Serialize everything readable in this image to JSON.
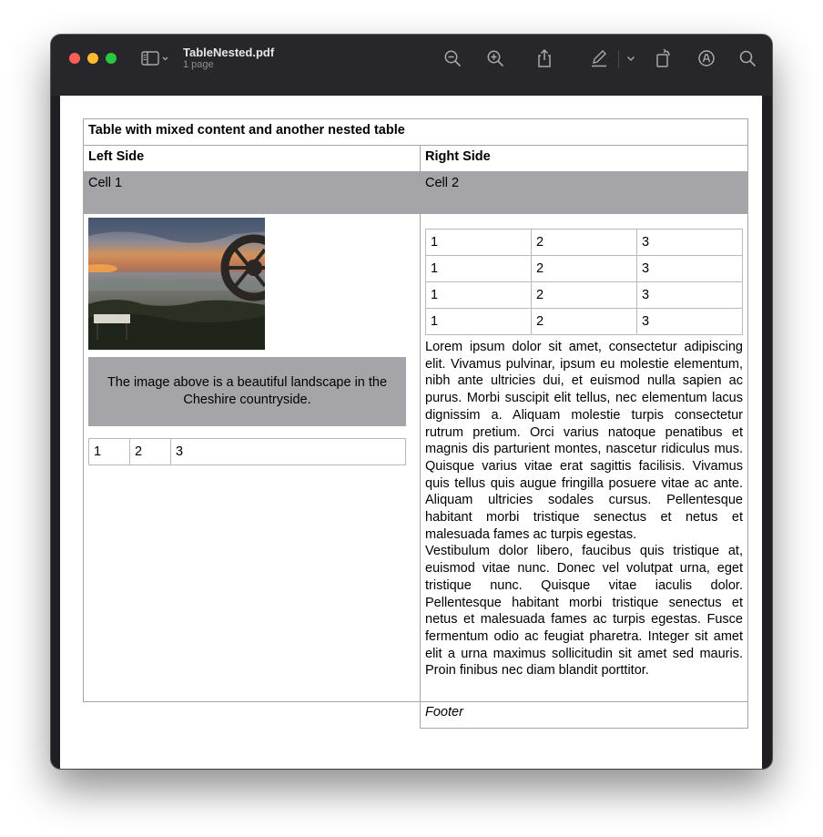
{
  "window": {
    "doc_title": "TableNested.pdf",
    "doc_subtitle": "1 page"
  },
  "toolbar": {
    "icons": [
      "sidebar-toggle-icon",
      "chevron-down-icon",
      "zoom-out-icon",
      "zoom-in-icon",
      "share-icon",
      "markup-pen-icon",
      "chevron-down-icon",
      "rotate-icon",
      "annotate-icon",
      "search-icon"
    ]
  },
  "document": {
    "table_title": "Table with mixed content and another nested table",
    "left_header": "Left Side",
    "right_header": "Right Side",
    "cell1": "Cell 1",
    "cell2": "Cell 2",
    "caption": "The image above is a beautiful landscape in the Cheshire countryside.",
    "left_nested_row": [
      "1",
      "2",
      "3"
    ],
    "right_nested_rows": [
      [
        "1",
        "2",
        "3"
      ],
      [
        "1",
        "2",
        "3"
      ],
      [
        "1",
        "2",
        "3"
      ],
      [
        "1",
        "2",
        "3"
      ]
    ],
    "lorem_p1": "Lorem ipsum dolor sit amet, consectetur adipiscing elit. Vivamus pulvinar, ipsum eu molestie elementum, nibh ante ultricies dui, et euismod nulla sapien ac purus. Morbi suscipit elit tellus, nec elementum lacus dignissim a. Aliquam molestie turpis consectetur rutrum pretium. Orci varius natoque penatibus et magnis dis parturient montes, nascetur ridiculus mus. Quisque varius vitae erat sagittis facilisis. Vivamus quis tellus quis augue fringilla posuere vitae ac ante. Aliquam ultricies sodales cursus. Pellentesque habitant morbi tristique senectus et netus et malesuada fames ac turpis egestas.",
    "lorem_p2": "Vestibulum dolor libero, faucibus quis tristique at, euismod vitae nunc. Donec vel volutpat urna, eget tristique nunc. Quisque vitae iaculis dolor. Pellentesque habitant morbi tristique senectus et netus et malesuada fames ac turpis egestas. Fusce fermentum odio ac feugiat pharetra. Integer sit amet elit a urna maximus sollicitudin sit amet sed mauris. Proin finibus nec diam blandit porttitor.",
    "footer": "Footer"
  }
}
